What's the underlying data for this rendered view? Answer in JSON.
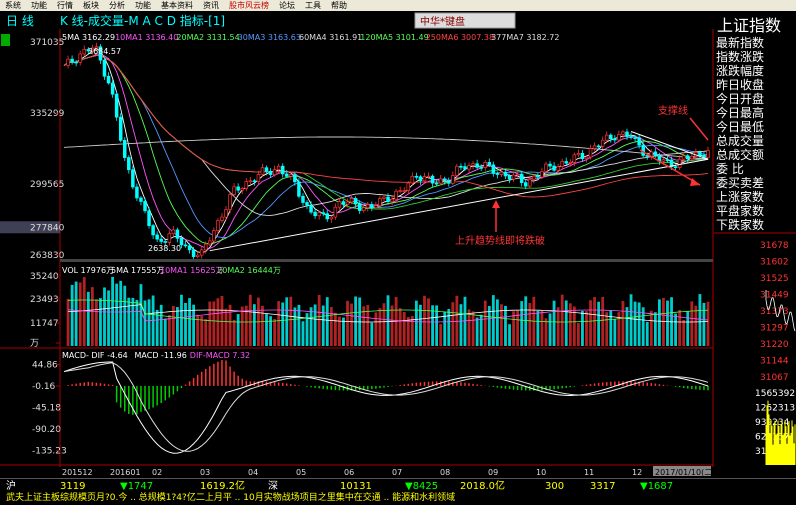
{
  "menu": [
    "系统",
    "功能",
    "行情",
    "板块",
    "分析",
    "功能",
    "基本资料",
    "资讯",
    "股市风云榜",
    "论坛",
    "工具",
    "帮助"
  ],
  "window": {
    "mode": "日 线",
    "title": "K 线-成交量-M A C D 指标-[1]",
    "logo": "中华*键盘"
  },
  "ma_legend": [
    {
      "label": "5MA 3162.29",
      "color": "#ffffff"
    },
    {
      "label": "10MA1 3136.40",
      "color": "#ff55ff"
    },
    {
      "label": "20MA2 3131.54",
      "color": "#55ff55"
    },
    {
      "label": "30MA3 3163.63",
      "color": "#5599ff"
    },
    {
      "label": "60MA4 3161.91",
      "color": "#dddddd"
    },
    {
      "label": "120MA5 3101.49",
      "color": "#55ff55"
    },
    {
      "label": "250MA6 3007.38",
      "color": "#ff4444"
    },
    {
      "label": "377MA7 3182.72",
      "color": "#dddddd"
    }
  ],
  "vol_legend": [
    {
      "label": "VOL 17976万",
      "color": "#ffffff"
    },
    {
      "label": "5MA 17555万",
      "color": "#ffffff"
    },
    {
      "label": "10MA1 15625万",
      "color": "#ff55ff"
    },
    {
      "label": "20MA2 16444万",
      "color": "#55ff55"
    }
  ],
  "macd_legend": [
    {
      "label": "MACD- DIF -4.64",
      "color": "#ffffff"
    },
    {
      "label": "MACD -11.96",
      "color": "#ffffff"
    },
    {
      "label": "DIF-MACD 7.32",
      "color": "#ff55ff"
    }
  ],
  "annotations": {
    "high_label": "3684.57",
    "low_label": "2638.30",
    "support": "支撑线",
    "uptrend": "上升趋势线即将跌破"
  },
  "sidebar": {
    "title": "上证指数",
    "rows": [
      "最新指数",
      "指数涨跌",
      "涨跌幅度",
      "昨日收盘",
      "今日开盘",
      "今日最高",
      "今日最低",
      "总成交量",
      "总成交额",
      "委  比",
      "委买卖差",
      "上涨家数",
      "平盘家数",
      "下跌家数"
    ],
    "price_ticks": [
      "31678",
      "31602",
      "31525",
      "31449",
      "31373",
      "31297",
      "31220",
      "31144",
      "31067"
    ],
    "vol_ticks": [
      "1565392",
      "1252313",
      "939234",
      "626157",
      "313078"
    ]
  },
  "status_bar": {
    "row1": [
      "沪",
      "3119",
      "▼1747",
      "1619.2亿",
      "深",
      "10131",
      "▼8425",
      "2018.0亿",
      "300",
      "3317",
      "▼1687"
    ],
    "row2": "武夫上证主板综规模页月?0.今 .. 总规模1?4?亿二上月平 .. 10月实物战场项目之里集中在交通 .. 能源和水利领域"
  },
  "chart_data": {
    "type": "candlestick",
    "x_axis_labels": [
      "201512",
      "201601",
      "02",
      "03",
      "04",
      "05",
      "06",
      "07",
      "08",
      "09",
      "10",
      "11",
      "12",
      "2017/01/10(二)"
    ],
    "price_axis": {
      "ticks": [
        3710.35,
        3352.99,
        2995.65,
        2777.84,
        2638.3
      ],
      "labels": [
        "371035",
        "335299",
        "299565",
        "277840",
        "263830"
      ],
      "ylim": [
        2638.3,
        3710.35
      ]
    },
    "volume_axis": {
      "ticks": [
        "35240",
        "23493",
        "11747",
        "万"
      ]
    },
    "macd_axis": {
      "ticks": [
        "44.86",
        "-0.16",
        "-45.18",
        "-90.20",
        "-135.23"
      ],
      "ylim": [
        -155,
        50
      ]
    },
    "price_series_approx": [
      {
        "x": "201512",
        "close": 3580
      },
      {
        "x": "201512",
        "close": 3650
      },
      {
        "x": "201512",
        "close": 3684.57
      },
      {
        "x": "201601",
        "close": 3500
      },
      {
        "x": "201601",
        "close": 3100
      },
      {
        "x": "201601",
        "close": 2900
      },
      {
        "x": "02",
        "close": 2700
      },
      {
        "x": "02",
        "close": 2750
      },
      {
        "x": "02",
        "close": 2670
      },
      {
        "x": "02",
        "close": 2638.3
      },
      {
        "x": "03",
        "close": 2800
      },
      {
        "x": "03",
        "close": 2950
      },
      {
        "x": "03",
        "close": 3010
      },
      {
        "x": "04",
        "close": 3050
      },
      {
        "x": "04",
        "close": 3080
      },
      {
        "x": "04",
        "close": 3000
      },
      {
        "x": "05",
        "close": 2860
      },
      {
        "x": "05",
        "close": 2820
      },
      {
        "x": "05",
        "close": 2900
      },
      {
        "x": "06",
        "close": 2900
      },
      {
        "x": "06",
        "close": 2870
      },
      {
        "x": "06",
        "close": 2930
      },
      {
        "x": "07",
        "close": 2950
      },
      {
        "x": "07",
        "close": 3050
      },
      {
        "x": "07",
        "close": 3000
      },
      {
        "x": "08",
        "close": 3020
      },
      {
        "x": "08",
        "close": 3080
      },
      {
        "x": "08",
        "close": 3100
      },
      {
        "x": "09",
        "close": 3060
      },
      {
        "x": "09",
        "close": 3040
      },
      {
        "x": "09",
        "close": 3000
      },
      {
        "x": "10",
        "close": 3050
      },
      {
        "x": "10",
        "close": 3090
      },
      {
        "x": "10",
        "close": 3110
      },
      {
        "x": "11",
        "close": 3150
      },
      {
        "x": "11",
        "close": 3200
      },
      {
        "x": "11",
        "close": 3250
      },
      {
        "x": "12",
        "close": 3230
      },
      {
        "x": "12",
        "close": 3150
      },
      {
        "x": "12",
        "close": 3110
      },
      {
        "x": "2017/01/10(二)",
        "close": 3100
      },
      {
        "x": "2017/01/10(二)",
        "close": 3140
      },
      {
        "x": "2017/01/10(二)",
        "close": 3160
      }
    ]
  }
}
